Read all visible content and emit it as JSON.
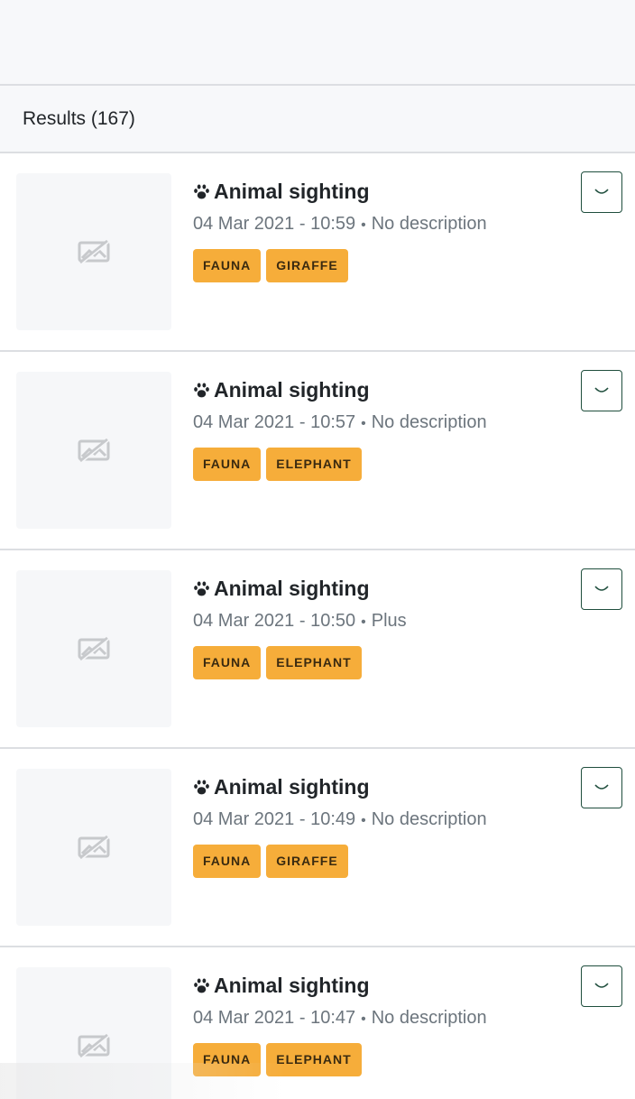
{
  "header": {
    "results_label": "Results (167)"
  },
  "icons": {
    "thumbnail": "image-off-icon",
    "category": "paw-icon",
    "toggle": "chevron-down-icon"
  },
  "colors": {
    "tag_bg": "#f6ad3a",
    "button_border": "#1f4e3d",
    "muted_text": "#6c757d"
  },
  "results": [
    {
      "title": "Animal sighting",
      "datetime": "04 Mar 2021 - 10:59",
      "separator": "•",
      "description": "No description",
      "tags": [
        "FAUNA",
        "GIRAFFE"
      ]
    },
    {
      "title": "Animal sighting",
      "datetime": "04 Mar 2021 - 10:57",
      "separator": "•",
      "description": "No description",
      "tags": [
        "FAUNA",
        "ELEPHANT"
      ]
    },
    {
      "title": "Animal sighting",
      "datetime": "04 Mar 2021 - 10:50",
      "separator": "•",
      "description": "Plus",
      "tags": [
        "FAUNA",
        "ELEPHANT"
      ]
    },
    {
      "title": "Animal sighting",
      "datetime": "04 Mar 2021 - 10:49",
      "separator": "•",
      "description": "No description",
      "tags": [
        "FAUNA",
        "GIRAFFE"
      ]
    },
    {
      "title": "Animal sighting",
      "datetime": "04 Mar 2021 - 10:47",
      "separator": "•",
      "description": "No description",
      "tags": [
        "FAUNA",
        "ELEPHANT"
      ]
    }
  ]
}
